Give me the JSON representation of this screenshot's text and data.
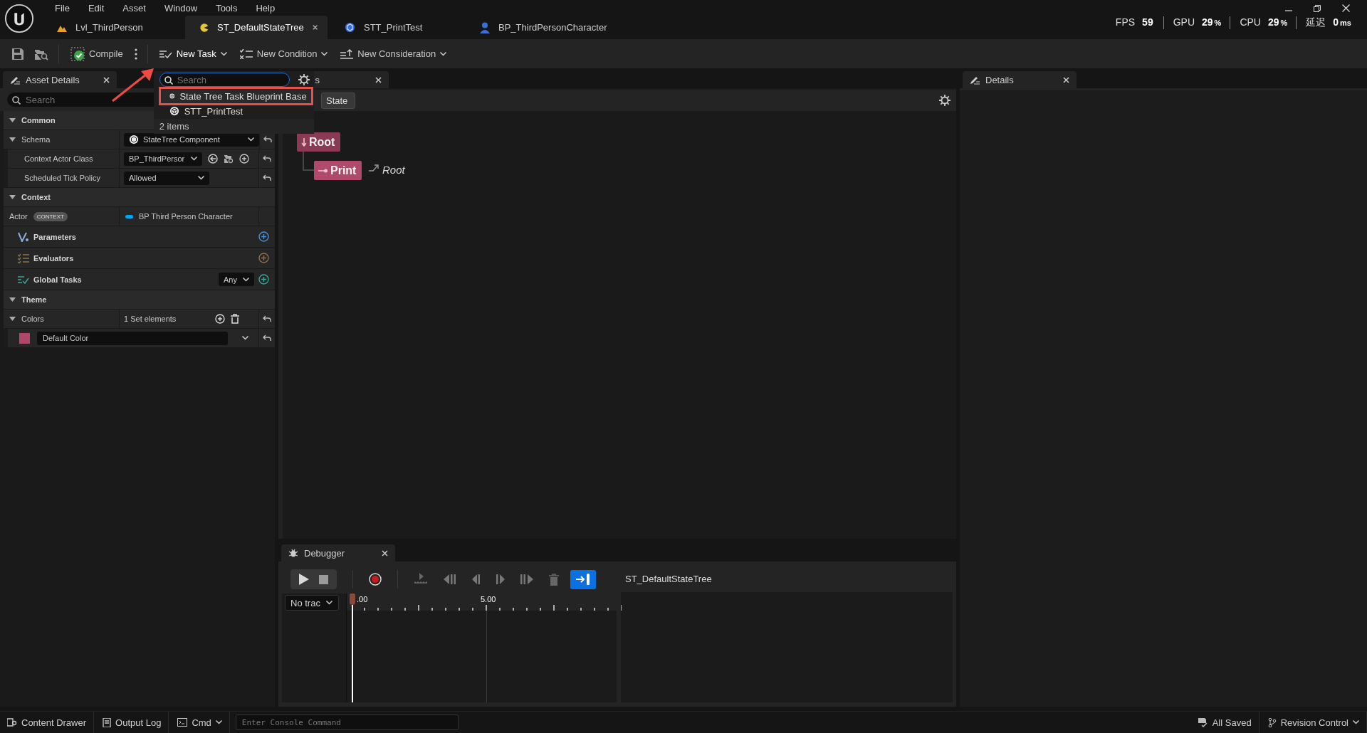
{
  "window": {
    "menu": [
      "File",
      "Edit",
      "Asset",
      "Window",
      "Tools",
      "Help"
    ],
    "tabs": [
      {
        "label": "Lvl_ThirdPerson",
        "selected": false,
        "kind": "level"
      },
      {
        "label": "ST_DefaultStateTree",
        "selected": true,
        "kind": "statetree"
      },
      {
        "label": "STT_PrintTest",
        "selected": false,
        "kind": "blueprint"
      },
      {
        "label": "BP_ThirdPersonCharacter",
        "selected": false,
        "kind": "character"
      }
    ],
    "stats": [
      {
        "label": "FPS",
        "value": "59"
      },
      {
        "label": "GPU",
        "value": "29",
        "unit": "%"
      },
      {
        "label": "CPU",
        "value": "29",
        "unit": "%"
      },
      {
        "label": "延迟",
        "value": "0",
        "unit": "ms"
      }
    ]
  },
  "toolbar": {
    "compile": "Compile",
    "menus": [
      {
        "label": "New Task",
        "kind": "task",
        "open": true
      },
      {
        "label": "New Condition",
        "kind": "condition",
        "open": false
      },
      {
        "label": "New Consideration",
        "kind": "consideration",
        "open": false
      }
    ]
  },
  "task_menu": {
    "placeholder": "Search",
    "items": [
      {
        "label": "State Tree Task Blueprint Base",
        "selected": true
      },
      {
        "label": "STT_PrintTest",
        "selected": false
      }
    ],
    "count": "2 items"
  },
  "asset_details": {
    "title": "Asset Details",
    "placeholder": "Search",
    "groups": [
      {
        "kind": "section",
        "title": "Common",
        "expanded": true,
        "rows": [
          {
            "kind": "schema",
            "label": "Schema",
            "value": "StateTree Component",
            "expanded": true,
            "children": [
              {
                "kind": "class",
                "label": "Context Actor Class",
                "value": "BP_ThirdPersor"
              },
              {
                "kind": "combo",
                "label": "Scheduled Tick Policy",
                "value": "Allowed"
              }
            ]
          }
        ]
      },
      {
        "kind": "section",
        "title": "Context",
        "expanded": true,
        "rows": [
          {
            "kind": "context",
            "label": "Actor",
            "badge": "CONTEXT",
            "value": "BP Third Person Character"
          }
        ]
      },
      {
        "kind": "parameters",
        "title": "Parameters"
      },
      {
        "kind": "evaluators",
        "title": "Evaluators"
      },
      {
        "kind": "tasks",
        "title": "Global Tasks",
        "filter": "Any"
      },
      {
        "kind": "section",
        "title": "Theme",
        "expanded": true,
        "rows": [
          {
            "kind": "set",
            "label": "Colors",
            "value": "1 Set elements",
            "expanded": true,
            "children": [
              {
                "kind": "color",
                "value": "Default Color",
                "color": "#b0466a"
              }
            ]
          }
        ]
      }
    ]
  },
  "states_panel": {
    "title": "s",
    "add_state": "State",
    "nodes": [
      {
        "label": "Root",
        "kind": "root",
        "children": [
          {
            "label": "Print",
            "kind": "leaf",
            "transition": "Root"
          }
        ]
      }
    ]
  },
  "debugger": {
    "title": "Debugger",
    "track_filter": "No trac",
    "ticks": [
      ".00",
      "5.00"
    ],
    "asset": "ST_DefaultStateTree"
  },
  "details": {
    "title": "Details"
  },
  "status_bar": {
    "left": [
      {
        "label": "Content Drawer",
        "kind": "drawer"
      },
      {
        "label": "Output Log",
        "kind": "log"
      },
      {
        "label": "Cmd",
        "kind": "cmd"
      }
    ],
    "console_placeholder": "Enter Console Command",
    "right": [
      {
        "label": "All Saved",
        "kind": "saved"
      },
      {
        "label": "Revision Control",
        "kind": "revision"
      }
    ]
  }
}
